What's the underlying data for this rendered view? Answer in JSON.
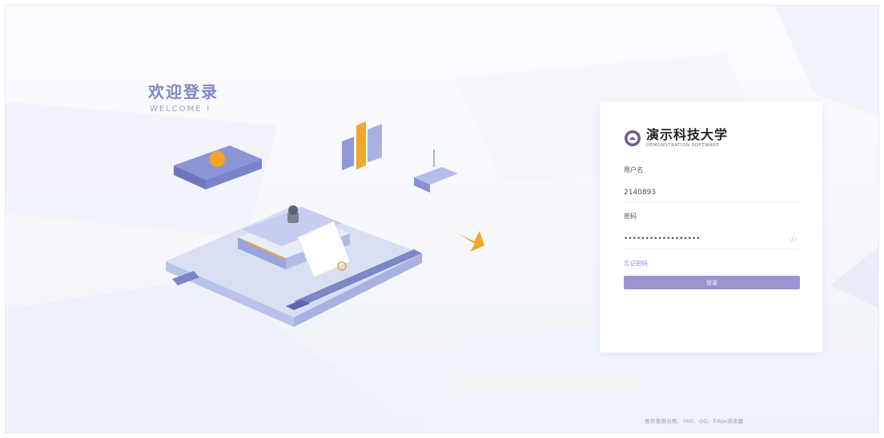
{
  "welcome": {
    "title": "欢迎登录",
    "subtitle": "WELCOME !"
  },
  "login": {
    "school_name": "演示科技大学",
    "school_name_en": "DEMONSTRATION SOFTWARE",
    "username_label": "用户名",
    "username_value": "2140893",
    "password_label": "密码",
    "password_value": "••••••••••••••••••",
    "forgot_label": "忘记密码",
    "submit_label": "登录"
  },
  "footer": {
    "browser_tip": "推荐使用谷歌、360、QQ、Edge浏览器"
  },
  "colors": {
    "accent": "#9a95cf",
    "title": "#7f88c4",
    "highlight": "#f3a52a"
  },
  "icons": {
    "logo": "school-emblem-icon",
    "password_toggle": "eye-icon"
  }
}
